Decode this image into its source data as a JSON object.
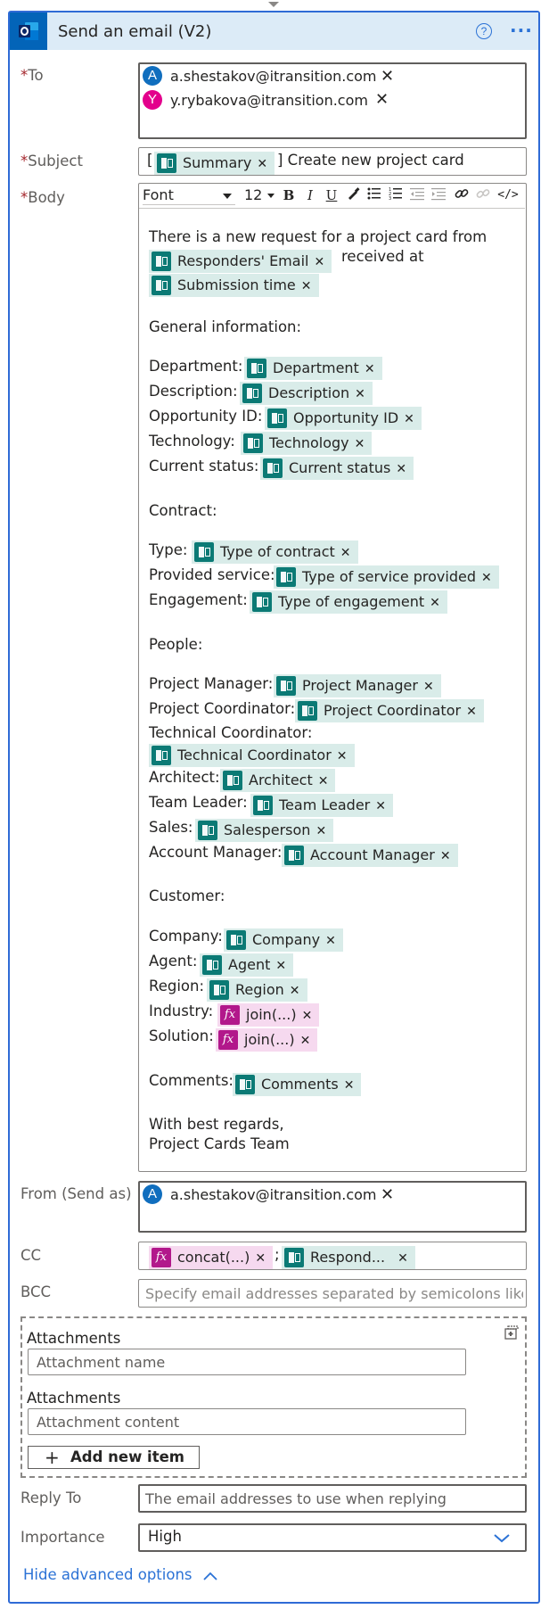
{
  "header": {
    "title": "Send an email (V2)",
    "help_glyph": "?",
    "more_glyph": "···"
  },
  "to": {
    "label": "To",
    "recipients": [
      {
        "initial": "A",
        "email": "a.shestakov@itransition.com",
        "color": "#106ebe"
      },
      {
        "initial": "Y",
        "email": "y.rybakova@itransition.com",
        "color": "#e3008c"
      }
    ]
  },
  "subject": {
    "label": "Subject",
    "prefix": "[",
    "token": "Summary",
    "suffix": "] Create new project card"
  },
  "body": {
    "label": "Body",
    "toolbar": {
      "font": "Font",
      "size": "12",
      "bold": "B",
      "italic": "I",
      "underline": "U",
      "code": "</>"
    },
    "intro": "There is a new request for a project card from",
    "responders_token": "Responders' Email",
    "received_at": "received at",
    "submission_token": "Submission time",
    "general_header": "General information:",
    "department_label": "Department:",
    "department_token": "Department",
    "description_label": "Description:",
    "description_token": "Description",
    "opportunity_label": "Opportunity ID:",
    "opportunity_token": "Opportunity ID",
    "technology_label": "Technology:",
    "technology_token": "Technology",
    "status_label": "Current status:",
    "status_token": "Current status",
    "contract_header": "Contract:",
    "type_label": "Type:",
    "type_token": "Type of contract",
    "service_label": "Provided service:",
    "service_token": "Type of service provided",
    "engagement_label": "Engagement:",
    "engagement_token": "Type of engagement",
    "people_header": "People:",
    "pm_label": "Project Manager:",
    "pm_token": "Project Manager",
    "pc_label": "Project Coordinator:",
    "pc_token": "Project Coordinator",
    "tc_label": "Technical Coordinator:",
    "tc_token": "Technical Coordinator",
    "architect_label": "Architect:",
    "architect_token": "Architect",
    "tl_label": "Team Leader:",
    "tl_token": "Team Leader",
    "sales_label": "Sales:",
    "sales_token": "Salesperson",
    "am_label": "Account Manager:",
    "am_token": "Account Manager",
    "customer_header": "Customer:",
    "company_label": "Company:",
    "company_token": "Company",
    "agent_label": "Agent:",
    "agent_token": "Agent",
    "region_label": "Region:",
    "region_token": "Region",
    "industry_label": "Industry:",
    "industry_token": "join(...)",
    "solution_label": "Solution:",
    "solution_token": "join(...)",
    "comments_label": "Comments:",
    "comments_token": "Comments",
    "regards": "With best regards,",
    "signature": "Project Cards Team"
  },
  "from": {
    "label": "From (Send as)",
    "initial": "A",
    "email": "a.shestakov@itransition.com"
  },
  "cc": {
    "label": "CC",
    "token1": "concat(...)",
    "separator": ";",
    "token2": "Respond..."
  },
  "bcc": {
    "label": "BCC",
    "placeholder": "Specify email addresses separated by semicolons like"
  },
  "attachments": [
    {
      "label": "Attachments",
      "placeholder": "Attachment name"
    },
    {
      "label": "Attachments",
      "placeholder": "Attachment content"
    }
  ],
  "add_item": "Add new item",
  "reply_to": {
    "label": "Reply To",
    "placeholder": "The email addresses to use when replying"
  },
  "importance": {
    "label": "Importance",
    "value": "High"
  },
  "hide_advanced": "Hide advanced options",
  "colors": {
    "accent": "#2b72d6",
    "token_bg": "#d9ece9",
    "fx_bg": "#f6d9ef",
    "required": "#a4262c"
  }
}
